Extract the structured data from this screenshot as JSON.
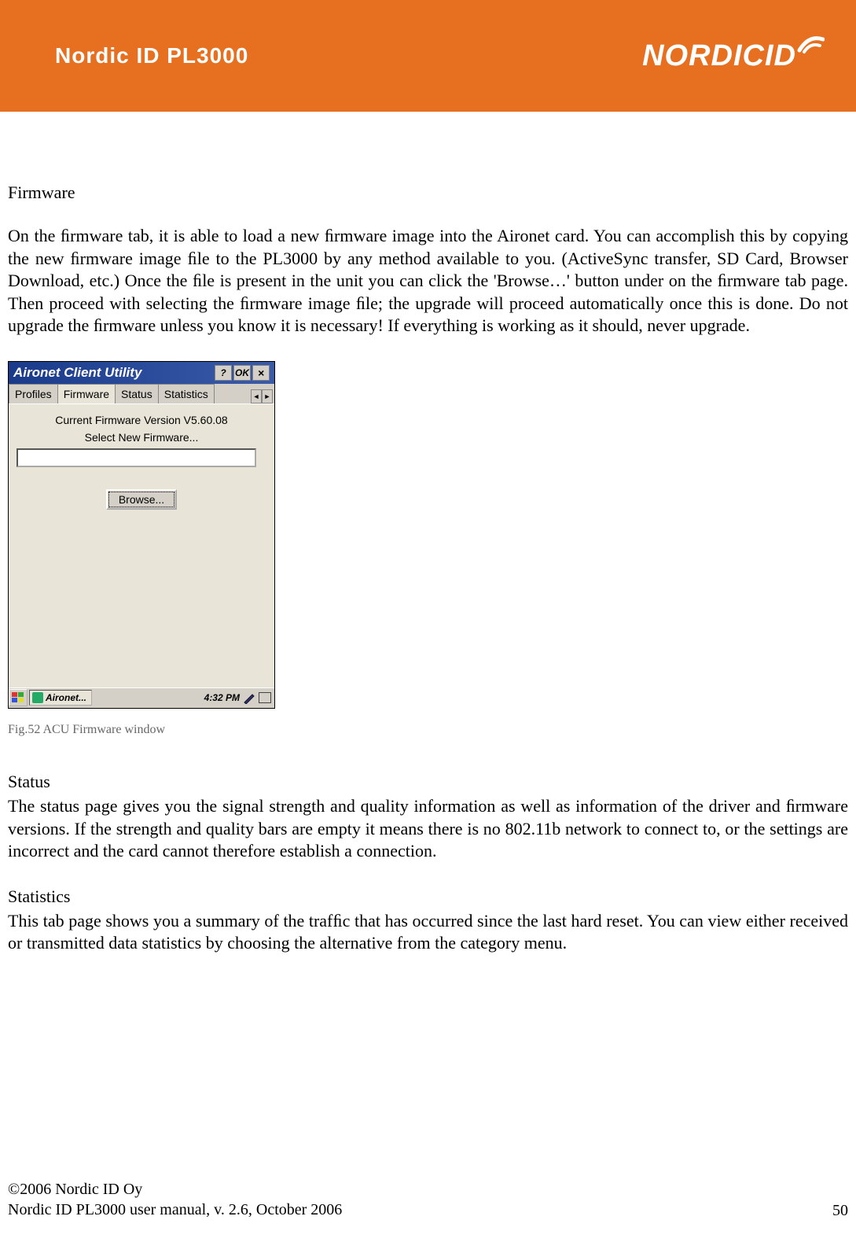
{
  "header": {
    "title": "Nordic ID PL3000",
    "logo_text": "NORDICID"
  },
  "sections": {
    "firmware_heading": "Firmware",
    "firmware_body": "On the ﬁrmware tab, it is able to load a new ﬁrmware image into the Aironet card. You can accomplish this by copying the new ﬁrmware image ﬁle to the PL3000 by any method available to you. (ActiveSync transfer, SD Card, Browser Download, etc.) Once the ﬁle is present in the unit you can click the 'Browse…' button under on the ﬁrmware tab page. Then proceed with selecting the ﬁrmware image ﬁle; the upgrade will proceed automatically once this is done. Do not upgrade the ﬁrmware unless you know it is necessary! If everything is working as it should, never upgrade.",
    "status_heading": "Status",
    "status_body": "The status page gives you the signal strength and quality information as well as information of the driver and ﬁrmware versions. If the strength and quality bars are empty it means there is no 802.11b network to connect to, or the settings are incorrect and the card cannot therefore establish a connection.",
    "statistics_heading": "Statistics",
    "statistics_body": "This tab page shows you a summary of the trafﬁc that has occurred since the last hard reset. You can view either received or transmitted data statistics by choosing the alternative from the category menu."
  },
  "dialog": {
    "title": "Aironet Client Utility",
    "help_btn": "?",
    "ok_btn": "OK",
    "close_btn": "×",
    "tabs": {
      "profiles": "Proﬁles",
      "firmware": "Firmware",
      "status": "Status",
      "statistics": "Statistics"
    },
    "current_fw": "Current Firmware Version V5.60.08",
    "select_label": "Select New Firmware...",
    "browse_label": "Browse...",
    "task_app": "Aironet...",
    "time": "4:32 PM"
  },
  "caption": "Fig.52 ACU Firmware window",
  "footer": {
    "copyright": "©2006 Nordic ID Oy",
    "manual": "Nordic ID PL3000 user manual, v. 2.6, October 2006",
    "page": "50"
  }
}
